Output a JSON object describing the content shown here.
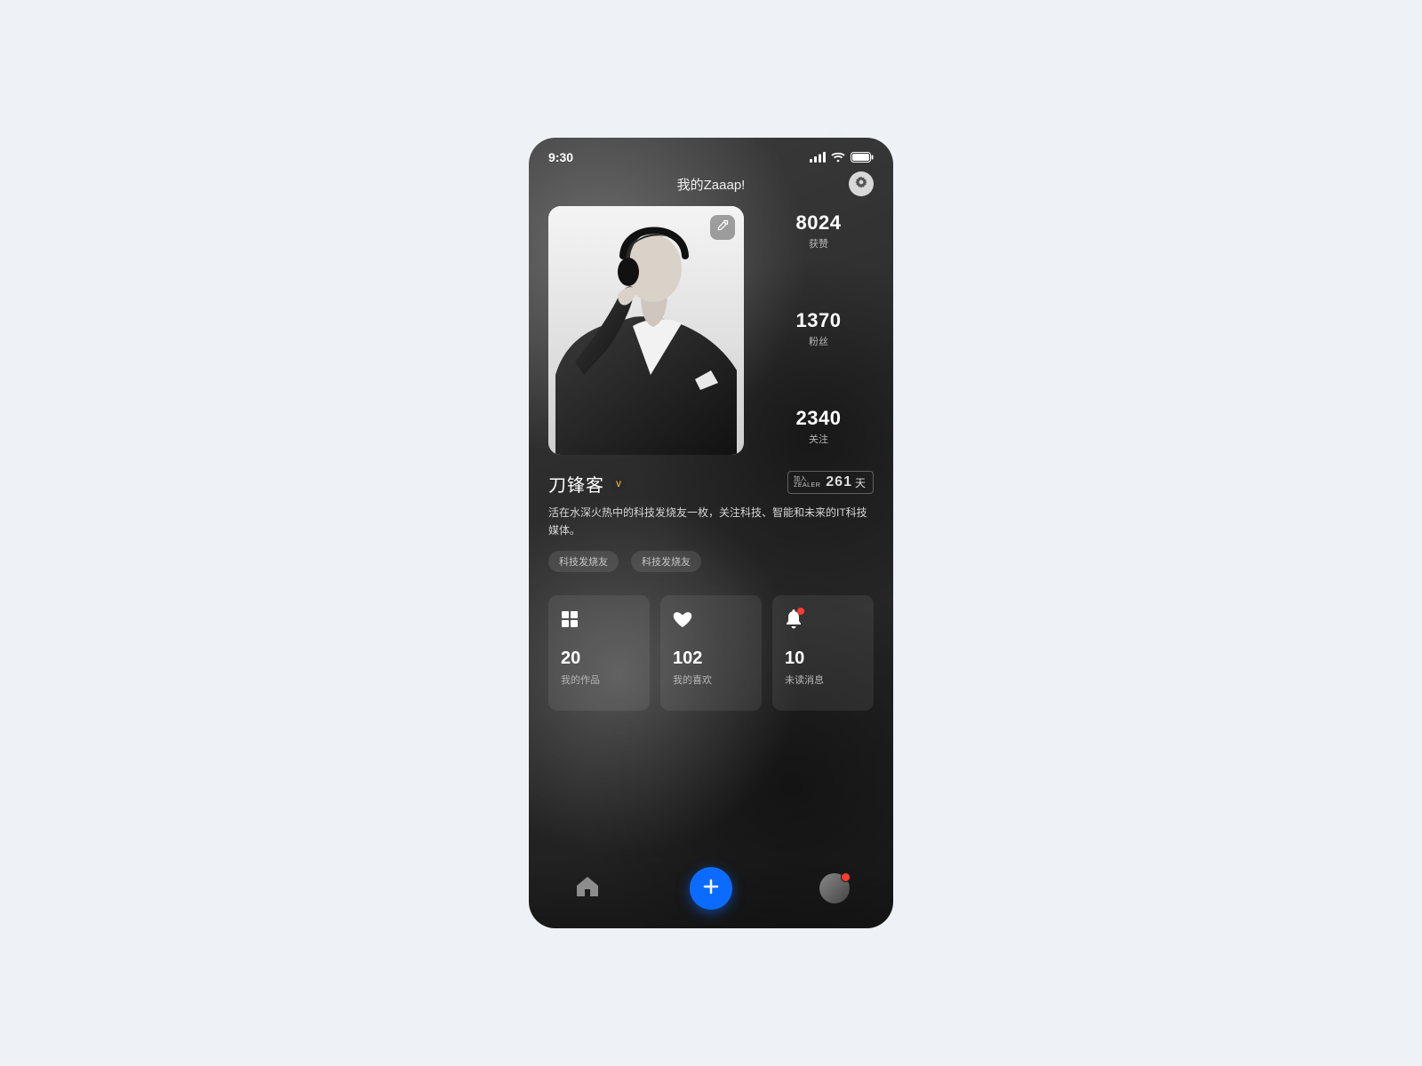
{
  "status": {
    "time": "9:30"
  },
  "header": {
    "title": "我的Zaaap!"
  },
  "stats": [
    {
      "value": "8024",
      "label": "获赞"
    },
    {
      "value": "1370",
      "label": "粉丝"
    },
    {
      "value": "2340",
      "label": "关注"
    }
  ],
  "profile": {
    "name": "刀锋客",
    "verified_letter": "V",
    "join_prefix_line1": "加入",
    "join_prefix_line2": "ZEALER",
    "join_days": "261",
    "join_suffix": "天",
    "bio": "活在水深火热中的科技发烧友一枚，关注科技、智能和未来的IT科技媒体。",
    "tags": [
      "科技发烧友",
      "科技发烧友"
    ]
  },
  "cards": [
    {
      "icon": "grid",
      "count": "20",
      "label": "我的作品"
    },
    {
      "icon": "heart",
      "count": "102",
      "label": "我的喜欢"
    },
    {
      "icon": "bell",
      "count": "10",
      "label": "未读消息",
      "dot": true
    }
  ]
}
